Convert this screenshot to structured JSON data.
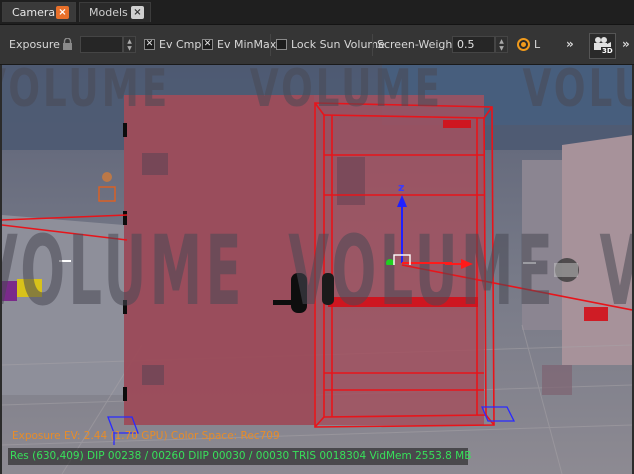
{
  "tabs": [
    {
      "label": "Camera",
      "close": "×",
      "active": true
    },
    {
      "label": "Models",
      "close": "×",
      "active": false
    }
  ],
  "toolbar": {
    "exposure_label": "Exposure",
    "exposure_value": "",
    "ev_cmp_label": "Ev Cmp",
    "ev_cmp_checked": true,
    "ev_minmax_label": "Ev MinMax",
    "ev_minmax_checked": true,
    "lock_sun_label": "Lock Sun Volume",
    "lock_sun_checked": false,
    "screen_weight_label": "Screen-Weight",
    "screen_weight_value": "0.5",
    "light_label": "L",
    "overflow_1": "»",
    "overflow_2": "»",
    "camera_3d_badge": "3D",
    "check_mark": "✕"
  },
  "viewport": {
    "watermark": "VOLUME",
    "axis_z_label": "z"
  },
  "status": {
    "exposure_line": "Exposure EV: 2.44 (1.70 GPU)  Color Space: Rec709",
    "stats_line": "Res (630,409)   DIP 00238 / 00260  DIIP 00030 / 00030  TRIS 0018304  VidMem 2553.8 MB"
  },
  "colors": {
    "accent_orange": "#e8702a",
    "selection_red": "#e8141a",
    "stats_green": "#38e05a",
    "exposure_text_orange": "#e88c28"
  },
  "icons": [
    "close-icon",
    "lock-icon",
    "spin-arrows-icon",
    "chevron-double-right-icon",
    "camera-3d-icon",
    "axis-gizmo-icon",
    "light-bulb-icon"
  ]
}
